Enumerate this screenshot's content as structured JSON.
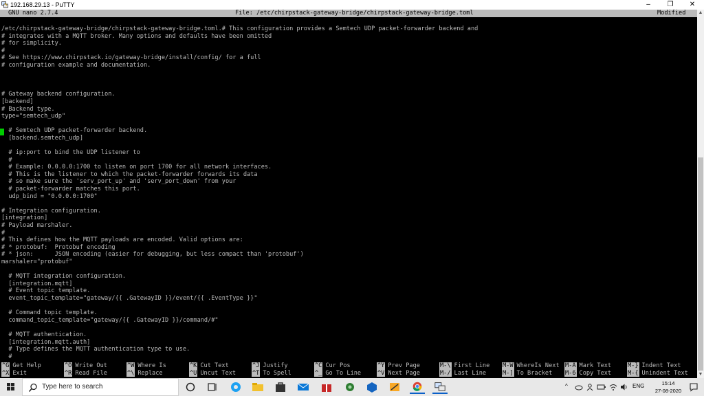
{
  "window": {
    "title": "192.168.29.13 - PuTTY",
    "minimize_glyph": "–",
    "maximize_glyph": "❐",
    "close_glyph": "✕"
  },
  "nano": {
    "version": "GNU nano 2.7.4",
    "file": "File: /etc/chirpstack-gateway-bridge/chirpstack-gateway-bridge.toml",
    "status": "Modified"
  },
  "editor_lines": [
    "/etc/chirpstack-gateway-bridge/chirpstack-gateway-bridge.toml.# This configuration provides a Semtech UDP packet-forwarder backend and",
    "# integrates with a MQTT broker. Many options and defaults have been omitted",
    "# for simplicity.",
    "#",
    "# See https://www.chirpstack.io/gateway-bridge/install/config/ for a full",
    "# configuration example and documentation.",
    "",
    "",
    "",
    "# Gateway backend configuration.",
    "[backend]",
    "# Backend type.",
    "type=\"semtech_udp\"",
    "",
    "  # Semtech UDP packet-forwarder backend.",
    "  [backend.semtech_udp]",
    "",
    "  # ip:port to bind the UDP listener to",
    "  #",
    "  # Example: 0.0.0.0:1700 to listen on port 1700 for all network interfaces.",
    "  # This is the listener to which the packet-forwarder forwards its data",
    "  # so make sure the 'serv_port_up' and 'serv_port_down' from your",
    "  # packet-forwarder matches this port.",
    "  udp_bind = \"0.0.0.0:1700\"",
    "",
    "# Integration configuration.",
    "[integration]",
    "# Payload marshaler.",
    "#",
    "# This defines how the MQTT payloads are encoded. Valid options are:",
    "# * protobuf:  Protobuf encoding",
    "# * json:      JSON encoding (easier for debugging, but less compact than 'protobuf')",
    "marshaler=\"protobuf\"",
    "",
    "  # MQTT integration configuration.",
    "  [integration.mqtt]",
    "  # Event topic template.",
    "  event_topic_template=\"gateway/{{ .GatewayID }}/event/{{ .EventType }}\"",
    "",
    "  # Command topic template.",
    "  command_topic_template=\"gateway/{{ .GatewayID }}/command/#\"",
    "",
    "  # MQTT authentication.",
    "  [integration.mqtt.auth]",
    "  # Type defines the MQTT authentication type to use.",
    "  #"
  ],
  "shortcuts": [
    {
      "key1": "^G",
      "label1": "Get Help",
      "key2": "^X",
      "label2": "Exit"
    },
    {
      "key1": "^O",
      "label1": "Write Out",
      "key2": "^R",
      "label2": "Read File"
    },
    {
      "key1": "^W",
      "label1": "Where Is",
      "key2": "^\\",
      "label2": "Replace"
    },
    {
      "key1": "^K",
      "label1": "Cut Text",
      "key2": "^U",
      "label2": "Uncut Text"
    },
    {
      "key1": "^J",
      "label1": "Justify",
      "key2": "^T",
      "label2": "To Spell"
    },
    {
      "key1": "^C",
      "label1": "Cur Pos",
      "key2": "^_",
      "label2": "Go To Line"
    },
    {
      "key1": "^Y",
      "label1": "Prev Page",
      "key2": "^V",
      "label2": "Next Page"
    },
    {
      "key1": "M-\\",
      "label1": "First Line",
      "key2": "M-/",
      "label2": "Last Line"
    },
    {
      "key1": "M-W",
      "label1": "WhereIs Next",
      "key2": "M-]",
      "label2": "To Bracket"
    },
    {
      "key1": "M-A",
      "label1": "Mark Text",
      "key2": "M-6",
      "label2": "Copy Text"
    },
    {
      "key1": "M-}",
      "label1": "Indent Text",
      "key2": "M-{",
      "label2": "Unindent Text"
    }
  ],
  "taskbar": {
    "search_placeholder": "Type here to search",
    "language": "ENG",
    "time": "15:14",
    "date": "27-08-2020",
    "tray_chevron": "^"
  },
  "colors": {
    "terminal_bg": "#000000",
    "terminal_fg": "#bbbbbb",
    "cursor": "#00cc00",
    "accent": "#0a60c8"
  }
}
